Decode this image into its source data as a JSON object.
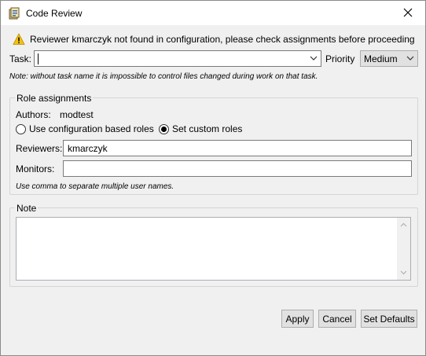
{
  "window": {
    "title": "Code Review",
    "icon": "code-review-app-icon",
    "close_icon": "close-icon"
  },
  "warning": {
    "icon": "warning-icon",
    "text": "Reviewer kmarczyk not found in configuration, please check assignments before proceeding"
  },
  "task": {
    "label": "Task:",
    "value": "",
    "note": "Note: without task name it is impossible to control files changed during work on that task."
  },
  "priority": {
    "label": "Priority",
    "selected": "Medium"
  },
  "role_assignments": {
    "title": "Role assignments",
    "authors_label": "Authors:",
    "authors_value": "modtest",
    "radio_config_label": "Use configuration based roles",
    "radio_custom_label": "Set custom roles",
    "selected_radio": "custom",
    "reviewers_label": "Reviewers:",
    "reviewers_value": "kmarczyk",
    "monitors_label": "Monitors:",
    "monitors_value": "",
    "hint": "Use comma to separate multiple user names."
  },
  "note_group": {
    "title": "Note",
    "value": ""
  },
  "buttons": {
    "apply": "Apply",
    "cancel": "Cancel",
    "set_defaults": "Set Defaults"
  },
  "colors": {
    "dialog_bg": "#f0f0f0",
    "warning_yellow": "#f5c211",
    "button_bg": "#e1e1e1"
  }
}
